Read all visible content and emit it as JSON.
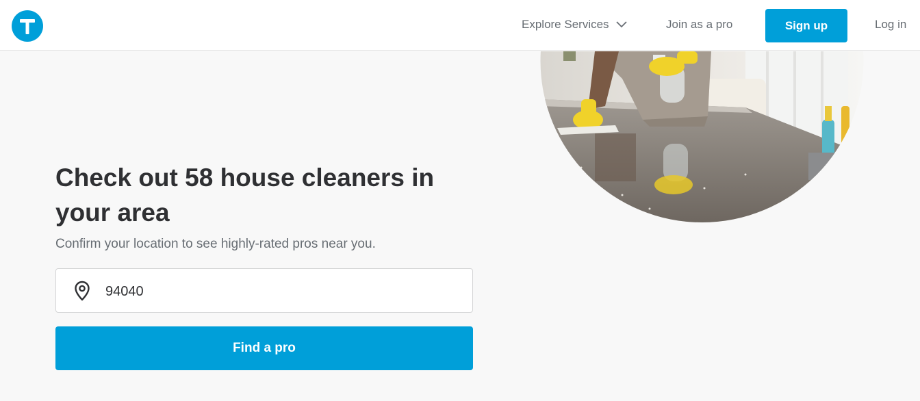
{
  "header": {
    "logo_icon": "thumbtack-logo-icon",
    "explore_label": "Explore Services",
    "join_label": "Join as a pro",
    "signup_label": "Sign up",
    "login_label": "Log in"
  },
  "hero": {
    "headline": "Check out 58 house cleaners in your area",
    "subheadline": "Confirm your location to see highly-rated pros near you."
  },
  "zip_field": {
    "icon": "location-pin-icon",
    "value": "94040"
  },
  "find_button": {
    "label": "Find a pro"
  },
  "colors": {
    "brand": "#009fd9",
    "page_bg": "#f8f8f8",
    "text_dark": "#2f3033",
    "text_muted": "#676d73"
  }
}
